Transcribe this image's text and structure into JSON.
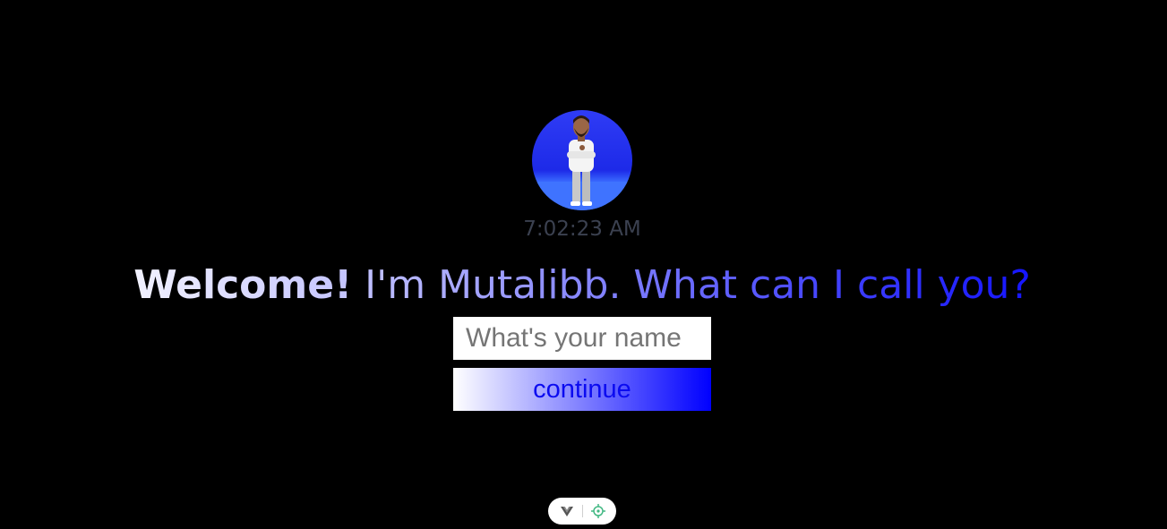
{
  "profile": {
    "avatar_label": "avatar",
    "time": "7:02:23 AM"
  },
  "greeting": {
    "bold": "Welcome!",
    "rest": " I'm Mutalibb. What can I call you?"
  },
  "form": {
    "name_placeholder": "What's your name",
    "name_value": "",
    "continue_label": "continue"
  },
  "devtools": {
    "icons": [
      "vue-logo-icon",
      "crosshair-icon"
    ]
  },
  "colors": {
    "background": "#000000",
    "avatar_bg": "#1d2ae8",
    "time_text": "#3b4150",
    "gradient_start": "#ffffff",
    "gradient_end": "#0000ff"
  }
}
